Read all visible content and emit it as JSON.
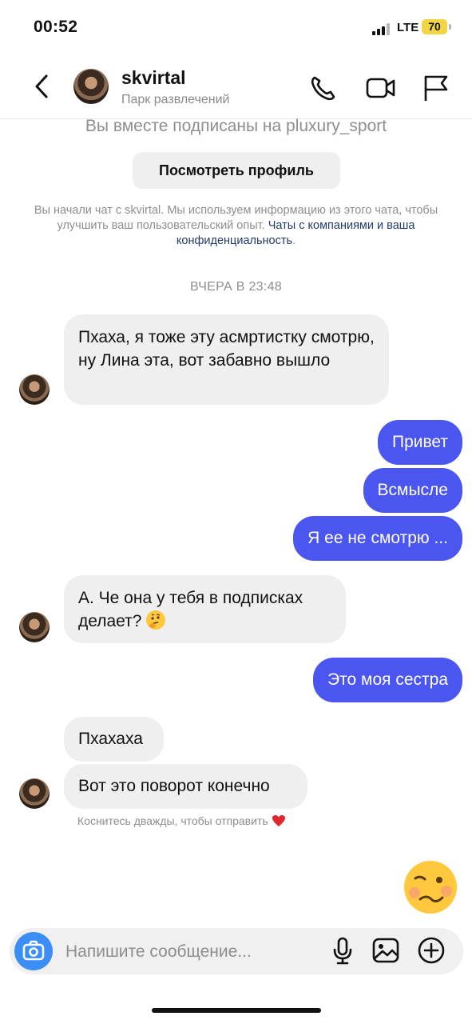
{
  "status_bar": {
    "time": "00:52",
    "network": "LTE",
    "battery": "70"
  },
  "header": {
    "username": "skvirtal",
    "subtitle": "Парк развлечений",
    "icons": [
      "back-icon",
      "phone-icon",
      "video-icon",
      "flag-icon"
    ]
  },
  "intro": {
    "mutual_follow": "Вы вместе подписаны на pluxury_sport",
    "view_profile": "Посмотреть профиль",
    "info_text": "Вы начали чат с skvirtal. Мы используем информацию из этого чата, чтобы улучшить ваш пользовательский опыт. ",
    "info_link": "Чаты с компаниями и ваша конфиденциальность",
    "info_end": "."
  },
  "day_label": "ВЧЕРА В 23:48",
  "messages": [
    {
      "side": "in",
      "text": "Пхаха, я тоже эту асмртистку смотрю, ну Лина эта, вот забавно вышло"
    },
    {
      "side": "out",
      "text": "Привет"
    },
    {
      "side": "out",
      "text": "Всмысле"
    },
    {
      "side": "out",
      "text": "Я ее не смотрю ..."
    },
    {
      "side": "in",
      "text": "А. Че она у тебя в подписках делает?",
      "emoji": "thinking-face"
    },
    {
      "side": "out",
      "text": "Это моя сестра"
    },
    {
      "side": "in",
      "text": "Пхахаха"
    },
    {
      "side": "in",
      "text": "Вот это поворот конечно"
    }
  ],
  "double_tap_hint": "Коснитесь дважды, чтобы отправить",
  "reaction_emoji": "woozy-face",
  "composer": {
    "placeholder": "Напишите сообщение...",
    "icons": [
      "camera-icon",
      "microphone-icon",
      "gallery-icon",
      "plus-icon"
    ]
  },
  "colors": {
    "outgoing_bubble": "#4b55f0",
    "incoming_bubble": "#efefef",
    "camera_button": "#3a8ef6",
    "battery": "#f2d542"
  }
}
